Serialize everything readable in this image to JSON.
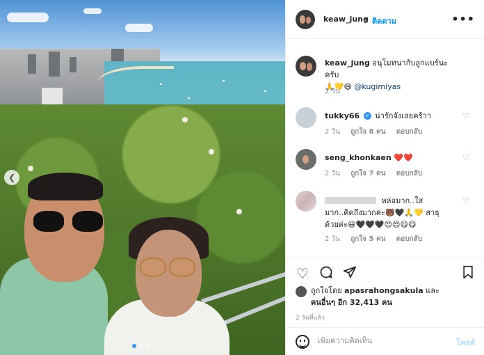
{
  "post": {
    "username": "keaw_jung",
    "follow_label": "ติดตาม",
    "separator": "•",
    "more_icon": "•••"
  },
  "caption": {
    "username": "keaw_jung",
    "text": "อนุโมทนากับลูกแบร์นะครับ",
    "emojis": "🙏💛😄",
    "mention": "@kugimiyas",
    "time": "2 วัน"
  },
  "comments": [
    {
      "username": "tukky66",
      "verified": true,
      "text": "น่ารักจังเลยคร้าา",
      "time": "2 วัน",
      "likes": "ถูกใจ 8 คน",
      "reply": "ตอบกลับ"
    },
    {
      "username": "seng_khonkaen",
      "text": "❤️❤️",
      "time": "2 วัน",
      "likes": "ถูกใจ 7 คน",
      "reply": "ตอบกลับ"
    },
    {
      "username": "",
      "text_line1": "หล่อมาก..ใส",
      "text_line2": "มาก..คิดถึงมากค่ะ🐻🖤🙏💛 สาธุ",
      "text_line3": "ด้วยค่ะ😄🖤🖤🖤😍😍😋😋",
      "time": "2 วัน",
      "likes": "ถูกใจ 5 คน",
      "reply": "ตอบกลับ"
    }
  ],
  "actions": {
    "like_icon": "heart-icon",
    "comment_icon": "comment-icon",
    "share_icon": "share-icon",
    "save_icon": "bookmark-icon"
  },
  "likes": {
    "prefix": "ถูกใจโดย",
    "user": "apasrahongsakula",
    "and": "และ",
    "others": "คนอื่นๆ อีก 32,413 คน"
  },
  "timeago": "2 วันที่แล้ว",
  "add_comment": {
    "placeholder": "เพิ่มความคิดเห็น",
    "post_label": "โพสต์"
  },
  "colors": {
    "link": "#0095f6",
    "text": "#262626",
    "muted": "#8e8e8e"
  }
}
